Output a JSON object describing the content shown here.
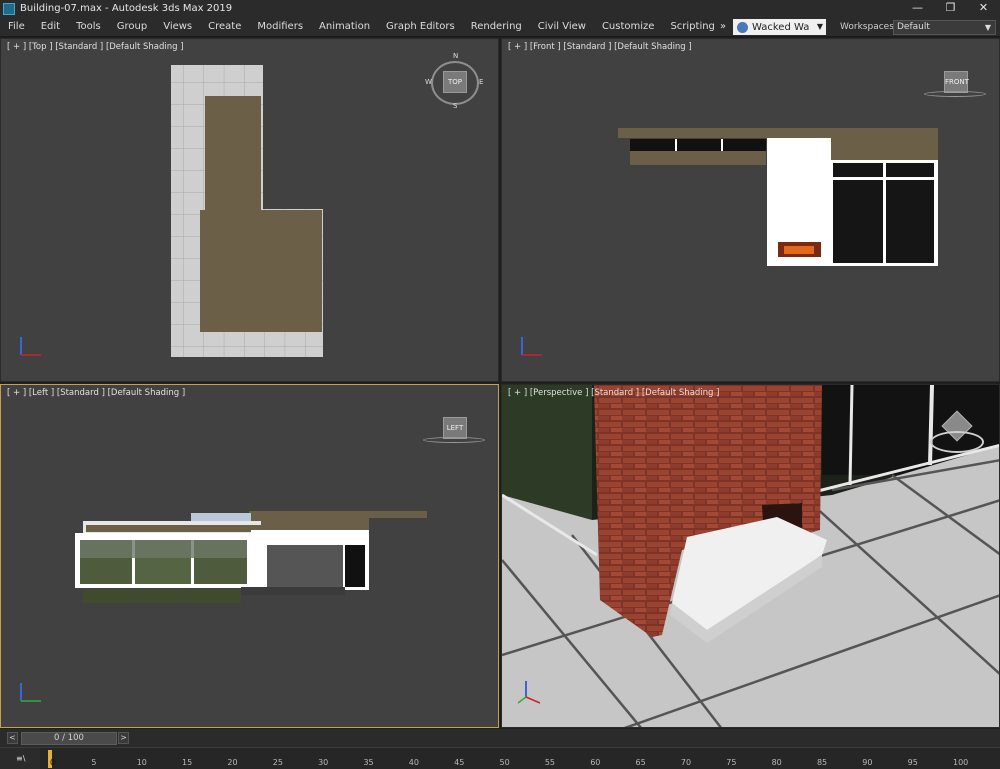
{
  "window": {
    "title": "Building-07.max - Autodesk 3ds Max 2019",
    "controls": [
      "—",
      "❐",
      "✕"
    ]
  },
  "menu": {
    "items": [
      "File",
      "Edit",
      "Tools",
      "Group",
      "Views",
      "Create",
      "Modifiers",
      "Animation",
      "Graph Editors",
      "Rendering",
      "Civil View",
      "Customize",
      "Scripting"
    ],
    "overflow": "»",
    "user": "Wacked Wa",
    "workspaces_label": "Workspaces:",
    "workspace_value": "Default"
  },
  "viewports": {
    "top": {
      "label": "[ + ] [Top ] [Standard ] [Default Shading ]",
      "compass": [
        "N",
        "E",
        "S",
        "W"
      ],
      "cube": "TOP"
    },
    "front": {
      "label": "[ + ] [Front ] [Standard ] [Default Shading ]",
      "cube": "FRONT"
    },
    "left": {
      "label": "[ + ] [Left ] [Standard ] [Default Shading ]",
      "cube": "LEFT"
    },
    "perspective": {
      "label": "[ + ] [Perspective ] [Standard ] [Default Shading ]"
    }
  },
  "timeline": {
    "frame_display": "0 / 100",
    "prev": "<",
    "next": ">",
    "ruler_ticks": [
      "0",
      "5",
      "10",
      "15",
      "20",
      "25",
      "30",
      "35",
      "40",
      "45",
      "50",
      "55",
      "60",
      "65",
      "70",
      "75",
      "80",
      "85",
      "90",
      "95",
      "100"
    ],
    "left_control": "≡\\"
  },
  "colors": {
    "viewport_bg": "#414141",
    "active_border": "#c7a04a",
    "wood": "#6c5f48",
    "brick": "#8a3a2a",
    "floor": "#c8c8c8"
  }
}
